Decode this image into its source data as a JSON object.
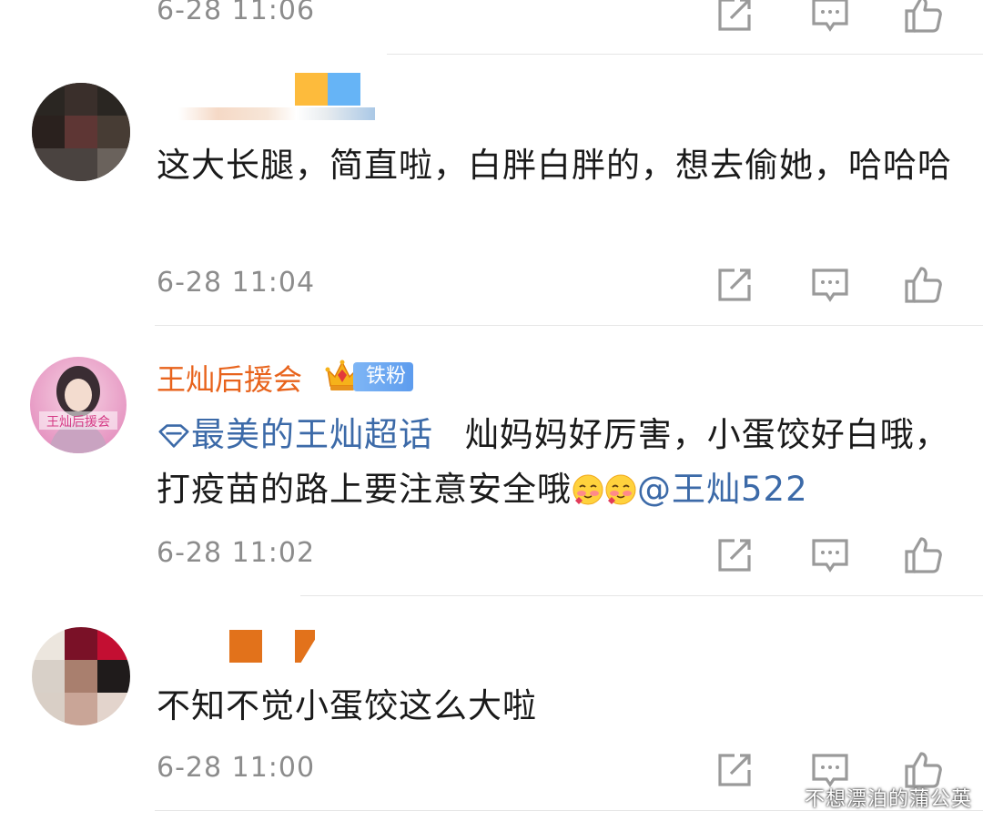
{
  "comments": [
    {
      "time": "6-28 11:06"
    },
    {
      "body": "这大长腿，简直啦，白胖白胖的，想去偷她，哈哈哈",
      "time": "6-28 11:04"
    },
    {
      "author": "王灿后援会",
      "badge": "铁粉",
      "topic": "最美的王灿超话",
      "body": "灿妈妈好厉害，小蛋饺好白哦，打疫苗的路上要注意安全哦",
      "mention": "@王灿522",
      "avatar_text": "王灿后援会",
      "time": "6-28 11:02"
    },
    {
      "body": "不知不觉小蛋饺这么大啦",
      "time": "6-28 11:00"
    }
  ],
  "watermark": "不想漂泊的蒲公英",
  "colors": {
    "author": "#e8631c",
    "link": "#3c6aa8",
    "time": "#8c8c8c",
    "icon": "#9a9a9a"
  },
  "icons": {
    "share": "share-icon",
    "reply": "comment-icon",
    "like": "thumbs-up-icon",
    "topic": "diamond-topic-icon",
    "crown": "crown-badge-icon",
    "emoji": "blush-emoji-icon"
  }
}
